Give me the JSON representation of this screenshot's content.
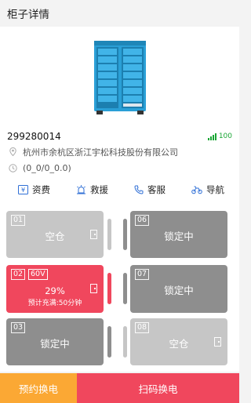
{
  "header": {
    "title": "柜子详情"
  },
  "cabinet": {
    "id": "299280014",
    "signal": "100",
    "address": "杭州市余杭区浙江宇松科技股份有限公司",
    "coords": "(0_0/0_0.0)",
    "image_icon": "battery-cabinet-image"
  },
  "actions": [
    {
      "label": "资费",
      "icon": "fee-icon"
    },
    {
      "label": "救援",
      "icon": "rescue-icon"
    },
    {
      "label": "客服",
      "icon": "phone-icon"
    },
    {
      "label": "导航",
      "icon": "navigation-icon"
    }
  ],
  "slots": [
    {
      "no": "01",
      "status": "空仓",
      "state": "empty",
      "level": 0
    },
    {
      "no": "02",
      "volt": "60V",
      "percent": "29%",
      "eta": "预计充满:50分钟",
      "state": "charging",
      "level": 0.29
    },
    {
      "no": "03",
      "status": "锁定中",
      "state": "locked",
      "level": 0
    },
    {
      "no": "06",
      "status": "锁定中",
      "state": "locked",
      "level": 0
    },
    {
      "no": "07",
      "status": "锁定中",
      "state": "locked",
      "level": 0
    },
    {
      "no": "08",
      "status": "空仓",
      "state": "empty",
      "level": 0
    }
  ],
  "footer": {
    "book_label": "预约换电",
    "scan_label": "扫码换电"
  },
  "colors": {
    "accent_red": "#f0475d",
    "accent_orange": "#fba834",
    "signal_green": "#19a634",
    "locked_gray": "#8e8e8e",
    "empty_gray": "#c6c6c6"
  }
}
